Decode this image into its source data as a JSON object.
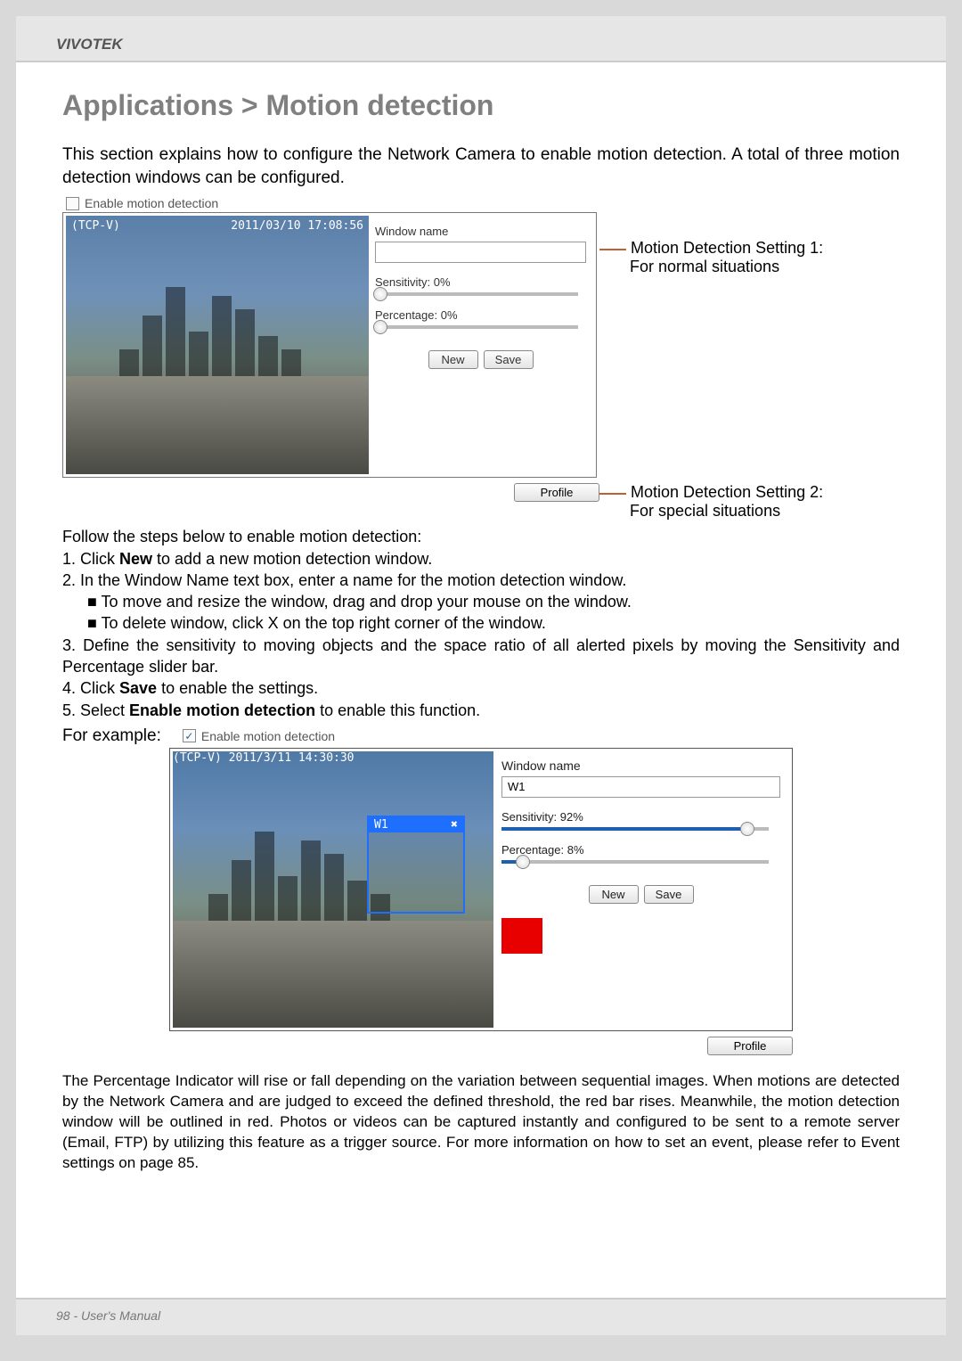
{
  "header": {
    "brand": "VIVOTEK"
  },
  "title": "Applications > Motion detection",
  "intro": "This section explains how to configure the Network Camera to enable motion detection. A total of three motion detection windows can be configured.",
  "fig1": {
    "enable_label": "Enable motion detection",
    "camera_id": "(TCP-V)",
    "timestamp": "2011/03/10 17:08:56",
    "window_name_label": "Window name",
    "window_name_value": "",
    "sensitivity_label": "Sensitivity: 0%",
    "sensitivity_pct": 0,
    "percentage_label": "Percentage: 0%",
    "percentage_pct": 0,
    "new_btn": "New",
    "save_btn": "Save",
    "profile_btn": "Profile"
  },
  "annotations": {
    "a1_l1": "Motion Detection Setting 1:",
    "a1_l2": "For normal situations",
    "a2_l1": "Motion Detection Setting 2:",
    "a2_l2": "For special situations"
  },
  "steps": {
    "lead": "Follow the steps below to enable motion detection:",
    "s1a": "1. Click ",
    "s1b_bold": "New",
    "s1c": " to add a new motion detection window.",
    "s2": "2. In the Window Name text box, enter a name for the motion detection window.",
    "s2a": "■ To move and resize the window, drag and drop your mouse on the window.",
    "s2b": "■ To delete window, click X on the top right corner of the window.",
    "s3": "3. Define the sensitivity to moving objects and the space ratio of all alerted pixels by moving the Sensitivity and Percentage slider bar.",
    "s4a": "4. Click ",
    "s4b_bold": "Save",
    "s4c": " to enable the settings.",
    "s5a": "5. Select ",
    "s5b_bold": "Enable motion detection",
    "s5c": " to enable this function."
  },
  "for_example": "For example:",
  "enable_checked_label": "Enable motion detection",
  "fig2": {
    "camera_id": "(TCP-V)",
    "timestamp": "2011/3/11 14:30:30",
    "md_window_label": "W1",
    "window_name_label": "Window name",
    "window_name_value": "W1",
    "sensitivity_label": "Sensitivity: 92%",
    "sensitivity_pct": 92,
    "percentage_label": "Percentage: 8%",
    "percentage_pct": 8,
    "new_btn": "New",
    "save_btn": "Save",
    "profile_btn": "Profile"
  },
  "para": "The Percentage Indicator will rise or fall depending on the variation between sequential images. When motions are detected by the Network Camera and are judged to exceed the defined threshold, the red bar rises. Meanwhile, the motion detection window will be outlined in red. Photos or videos can be captured instantly and configured to be sent to a remote server (Email, FTP) by utilizing this feature as a trigger source. For more information on how to set an event, please refer to Event settings on page 85.",
  "footer": "98 - User's Manual"
}
